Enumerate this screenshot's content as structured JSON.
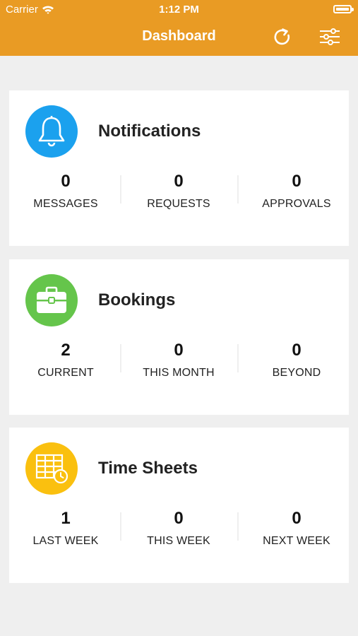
{
  "status": {
    "carrier": "Carrier",
    "time": "1:12 PM"
  },
  "header": {
    "title": "Dashboard"
  },
  "colors": {
    "accent": "#e99b24",
    "notifications": "#1ba1ee",
    "bookings": "#65c54b",
    "timesheets": "#fac00f"
  },
  "cards": [
    {
      "title": "Notifications",
      "icon": "bell-icon",
      "stats": [
        {
          "value": "0",
          "label": "MESSAGES"
        },
        {
          "value": "0",
          "label": "REQUESTS"
        },
        {
          "value": "0",
          "label": "APPROVALS"
        }
      ]
    },
    {
      "title": "Bookings",
      "icon": "briefcase-icon",
      "stats": [
        {
          "value": "2",
          "label": "CURRENT"
        },
        {
          "value": "0",
          "label": "THIS MONTH"
        },
        {
          "value": "0",
          "label": "BEYOND"
        }
      ]
    },
    {
      "title": "Time Sheets",
      "icon": "timesheet-icon",
      "stats": [
        {
          "value": "1",
          "label": "LAST WEEK"
        },
        {
          "value": "0",
          "label": "THIS WEEK"
        },
        {
          "value": "0",
          "label": "NEXT WEEK"
        }
      ]
    }
  ]
}
